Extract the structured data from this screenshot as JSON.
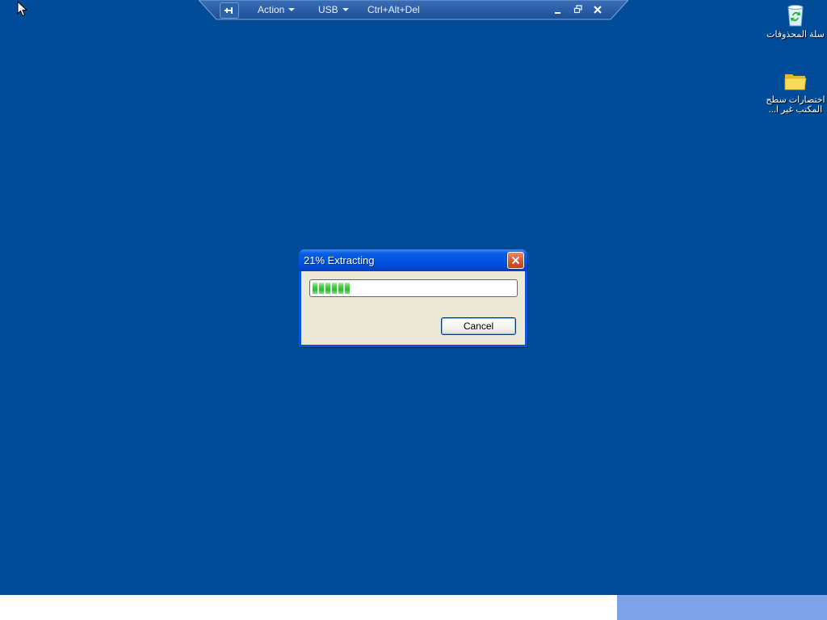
{
  "remote_toolbar": {
    "menus": [
      {
        "label": "Action",
        "has_dropdown": true
      },
      {
        "label": "USB",
        "has_dropdown": true
      },
      {
        "label": "Ctrl+Alt+Del",
        "has_dropdown": false
      }
    ],
    "icons": {
      "pin": "pin-icon",
      "minimize": "minimize-icon",
      "restore": "restore-icon",
      "close": "close-icon"
    }
  },
  "desktop": {
    "background_color": "#004c98",
    "icons": [
      {
        "label": "سلة المحذوفات",
        "icon": "recycle-bin-icon"
      },
      {
        "label": "اختصارات سطح المكتب غير ا...",
        "icon": "folder-icon"
      }
    ]
  },
  "dialog": {
    "title": "21% Extracting",
    "progress_percent": 21,
    "cancel_label": "Cancel",
    "close_icon": "close-icon"
  },
  "colors": {
    "desktop": "#004c98",
    "title_bar": "#0054e3",
    "dialog_body": "#ece9d8",
    "progress_fill": "#2bbe2b",
    "close_button": "#d85a34",
    "bottom_bar_right": "#7ea2e8"
  }
}
